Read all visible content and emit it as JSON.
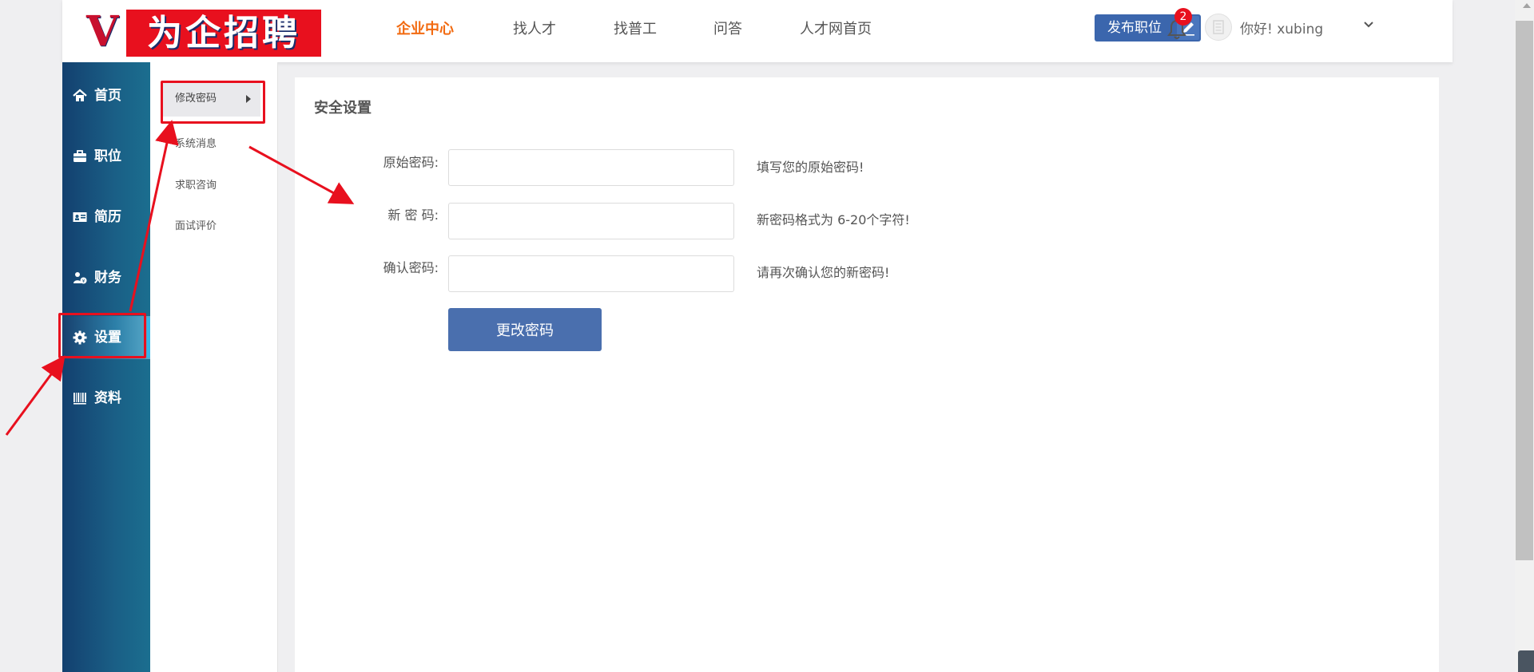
{
  "header": {
    "logo_letter": "V",
    "logo_text": "为企招聘",
    "nav": [
      {
        "label": "企业中心",
        "active": true
      },
      {
        "label": "找人才",
        "active": false
      },
      {
        "label": "找普工",
        "active": false
      },
      {
        "label": "问答",
        "active": false
      },
      {
        "label": "人才网首页",
        "active": false
      }
    ],
    "publish_button": "发布职位",
    "notification_count": "2",
    "greeting": "你好! xubing",
    "icons": [
      "edit-icon",
      "bell-icon",
      "avatar",
      "chevron-down-icon"
    ]
  },
  "sidebar": {
    "items": [
      {
        "label": "首页",
        "icon": "home-icon"
      },
      {
        "label": "职位",
        "icon": "briefcase-icon"
      },
      {
        "label": "简历",
        "icon": "id-card-icon"
      },
      {
        "label": "财务",
        "icon": "finance-icon"
      },
      {
        "label": "设置",
        "icon": "gear-icon",
        "active": true
      },
      {
        "label": "资料",
        "icon": "barcode-icon"
      }
    ]
  },
  "submenu": {
    "items": [
      {
        "label": "修改密码",
        "active": true
      },
      {
        "label": "系统消息"
      },
      {
        "label": "求职咨询"
      },
      {
        "label": "面试评价"
      }
    ]
  },
  "main": {
    "title": "安全设置",
    "form": {
      "fields": [
        {
          "label": "原始密码:",
          "value": "",
          "hint": "填写您的原始密码!"
        },
        {
          "label": "新 密 码:",
          "value": "",
          "hint": "新密码格式为 6-20个字符!"
        },
        {
          "label": "确认密码:",
          "value": "",
          "hint": "请再次确认您的新密码!"
        }
      ],
      "submit_label": "更改密码"
    }
  },
  "colors": {
    "accent_nav": "#f26a10",
    "primary_button": "#4a6fae",
    "sidebar_dark": "#13406f",
    "annotation_red": "#e8101e"
  }
}
